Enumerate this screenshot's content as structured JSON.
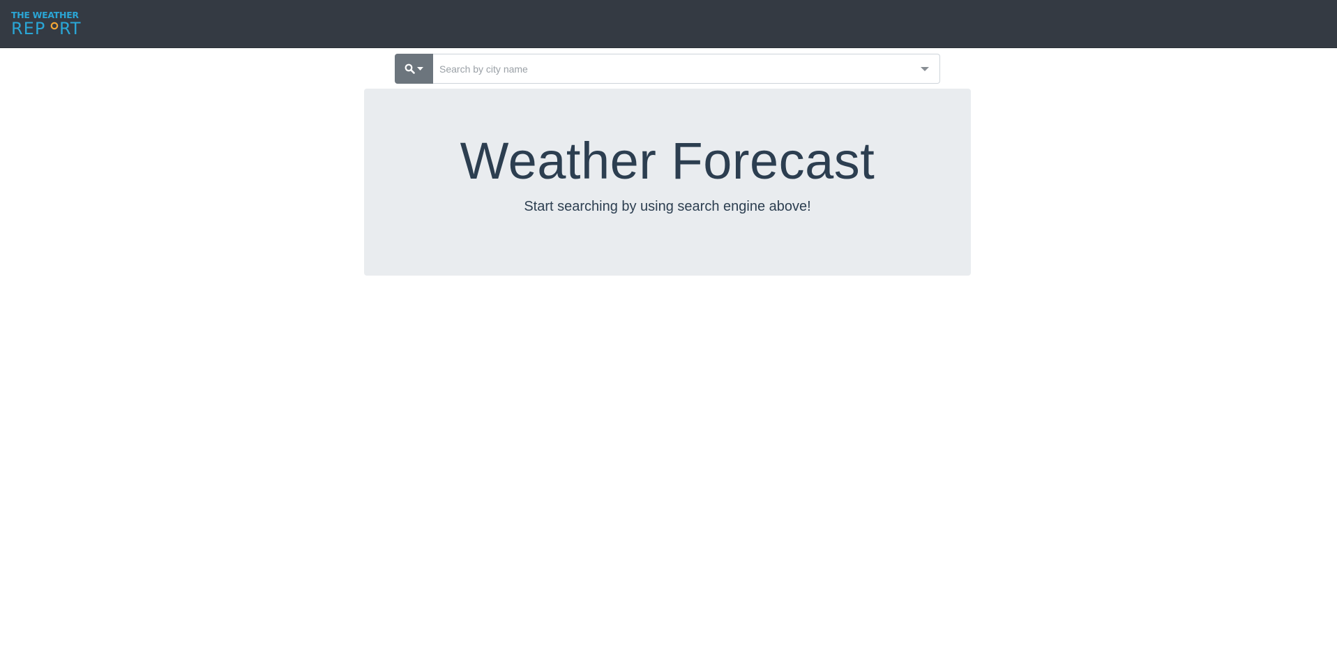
{
  "app": {
    "logo_line1": "THE WEATHER",
    "logo_line2": "REPORT",
    "logo_color": "#2aa6d6",
    "logo_accent_color": "#f4a736"
  },
  "search": {
    "button_icon": "search-icon",
    "dropdown_icon": "caret-down-icon",
    "placeholder": "Search by city name",
    "value": ""
  },
  "hero": {
    "title": "Weather Forecast",
    "subtitle": "Start searching by using search engine above!"
  },
  "colors": {
    "navbar": "#343a43",
    "button": "#6c757d",
    "jumbotron": "#e9ecef",
    "text": "#2c3e50"
  }
}
